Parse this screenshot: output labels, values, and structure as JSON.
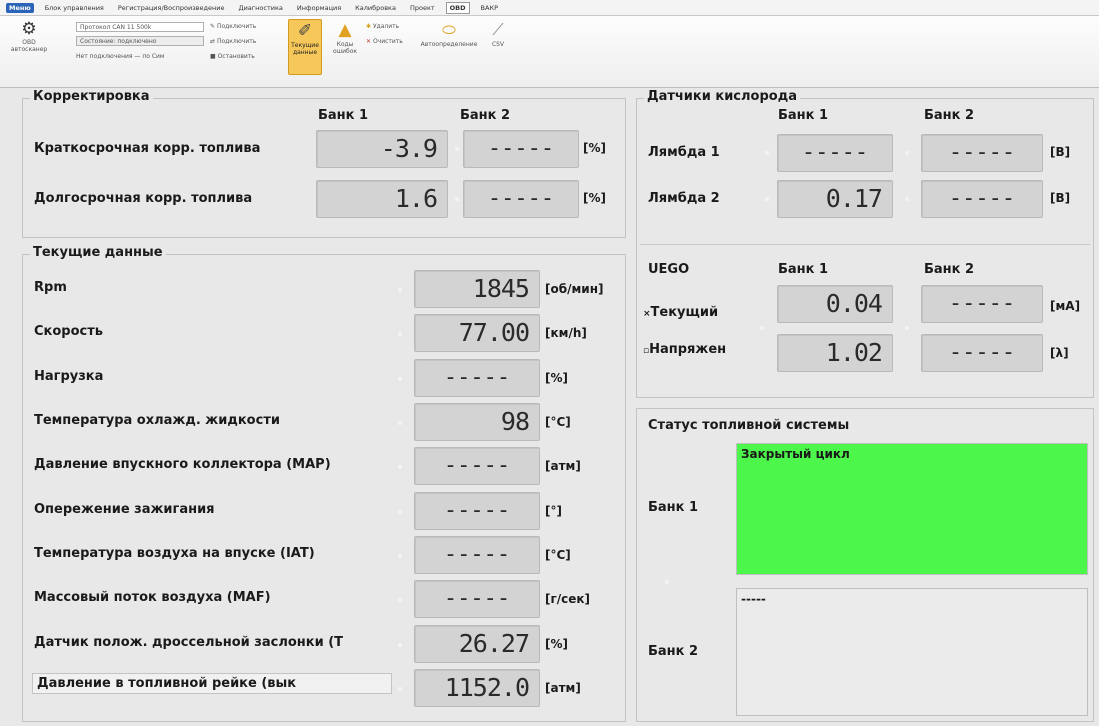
{
  "ribbon": {
    "tabs": [
      "Меню",
      "Блок управления",
      "Регистрация/Воспроизведение",
      "Диагностика",
      "Информация",
      "Калибровка",
      "Проект",
      "OBD",
      "ВАКР"
    ],
    "left_button_label": "OBD автосканер",
    "combo_protocol": "Протокол CAN 11 500k",
    "combo_status": "Состояние: подключено",
    "combo_hint": "Нет подключения — по Сим",
    "small_connect": "Подключить",
    "small_disconnect": "Подключить",
    "small_reset": "Остановить",
    "current_data_label": "Текущие данные",
    "error_codes_label": "Коды ошибок",
    "delete_label": "Удалить",
    "clear_label": "Очистить",
    "autodetect_label": "Автоопределение",
    "csv_label": "CSV"
  },
  "correction": {
    "title": "Корректировка",
    "bank1": "Банк 1",
    "bank2": "Банк 2",
    "rows": [
      {
        "label": "Краткосрочная корр. топлива",
        "b1": "-3.9",
        "b2": "-----",
        "unit": "[%]"
      },
      {
        "label": "Долгосрочная корр. топлива",
        "b1": "1.6",
        "b2": "-----",
        "unit": "[%]"
      }
    ]
  },
  "current": {
    "title": "Текущие данные",
    "rows": [
      {
        "label": "Rpm",
        "value": "1845",
        "unit": "[об/мин]"
      },
      {
        "label": "Скорость",
        "value": "77.00",
        "unit": "[км/h]"
      },
      {
        "label": "Нагрузка",
        "value": "-----",
        "unit": "[%]"
      },
      {
        "label": "Температура охлажд. жидкости",
        "value": "98",
        "unit": "[°C]"
      },
      {
        "label": "Давление впускного коллектора (MAP)",
        "value": "-----",
        "unit": "[атм]"
      },
      {
        "label": "Опережение зажигания",
        "value": "-----",
        "unit": "[°]"
      },
      {
        "label": "Температура воздуха на впуске (IAT)",
        "value": "-----",
        "unit": "[°C]"
      },
      {
        "label": "Массовый поток воздуха (MAF)",
        "value": "-----",
        "unit": "[г/сек]"
      },
      {
        "label": "Датчик полож. дроссельной заслонки (T",
        "value": "26.27",
        "unit": "[%]"
      },
      {
        "label": "Давление в топливной рейке (вык",
        "value": "1152.0",
        "unit": "[атм]"
      }
    ]
  },
  "oxygen": {
    "title": "Датчики кислорода",
    "bank1": "Банк 1",
    "bank2": "Банк 2",
    "rows": [
      {
        "label": "Лямбда 1",
        "b1": "-----",
        "b2": "-----",
        "unit": "[В]"
      },
      {
        "label": "Лямбда 2",
        "b1": "0.17",
        "b2": "-----",
        "unit": "[В]"
      }
    ]
  },
  "uego": {
    "title": "UEGO",
    "bank1": "Банк 1",
    "bank2": "Банк 2",
    "rows": [
      {
        "label": "Текущий",
        "b1": "0.04",
        "b2": "-----",
        "unit": "[мА]"
      },
      {
        "label": "Напряжен",
        "b1": "1.02",
        "b2": "-----",
        "unit": "[λ]"
      }
    ]
  },
  "fuel_status": {
    "title": "Статус топливной системы",
    "bank1_label": "Банк 1",
    "bank1_value": "Закрытый цикл",
    "bank1_color": "#4cf64a",
    "bank2_label": "Банк 2",
    "bank2_value": "-----"
  }
}
